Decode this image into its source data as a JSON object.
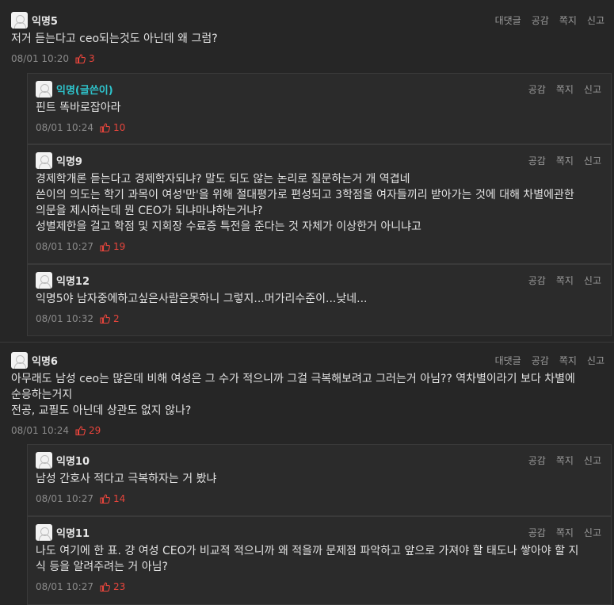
{
  "actions": {
    "reply": "대댓글",
    "like": "공감",
    "message": "쪽지",
    "report": "신고"
  },
  "comments": [
    {
      "nick": "익명5",
      "text": [
        "저거 듣는다고 ceo되는것도 아닌데 왜 그럼?"
      ],
      "time": "08/01 10:20",
      "votes": "3",
      "replies": [
        {
          "nick": "익명(글쓴이)",
          "text": [
            "핀트 똑바로잡아라"
          ],
          "time": "08/01 10:24",
          "votes": "10"
        },
        {
          "nick": "익명9",
          "text": [
            "경제학개론 듣는다고 경제학자되냐? 말도 되도 않는 논리로 질문하는거 개 역겹네",
            "쓴이의 의도는 학기 과목이 여성'만'을 위해 절대평가로 편성되고 3학점을 여자들끼리 받아가는 것에 대해 차별에관한",
            "의문을 제시하는데 뭔 CEO가 되냐마냐하는거냐?",
            "성별제한을 걸고 학점 및 지회장 수료증 특전을 준다는 것 자체가 이상한거 아니냐고"
          ],
          "time": "08/01 10:27",
          "votes": "19"
        },
        {
          "nick": "익명12",
          "text": [
            "익명5야 남자중에하고싶은사람은못하니 그렇지...머가리수준이...낮네..."
          ],
          "time": "08/01 10:32",
          "votes": "2"
        }
      ]
    },
    {
      "nick": "익명6",
      "text": [
        "아무래도 남성 ceo는 많은데 비해 여성은 그 수가 적으니까 그걸 극복해보려고 그러는거 아님?? 역차별이라기 보다 차별에",
        "순응하는거지",
        "전공, 교필도 아닌데 상관도 없지 않나?"
      ],
      "time": "08/01 10:24",
      "votes": "29",
      "replies": [
        {
          "nick": "익명10",
          "text": [
            "남성 간호사 적다고 극복하자는 거 봤냐"
          ],
          "time": "08/01 10:27",
          "votes": "14"
        },
        {
          "nick": "익명11",
          "text": [
            "나도 여기에 한 표. 걍 여성 CEO가 비교적 적으니까 왜 적을까 문제점 파악하고 앞으로 가져야 할 태도나 쌓아야 할 지",
            "식 등을 알려주려는 거 아님?"
          ],
          "time": "08/01 10:27",
          "votes": "23"
        }
      ]
    }
  ]
}
